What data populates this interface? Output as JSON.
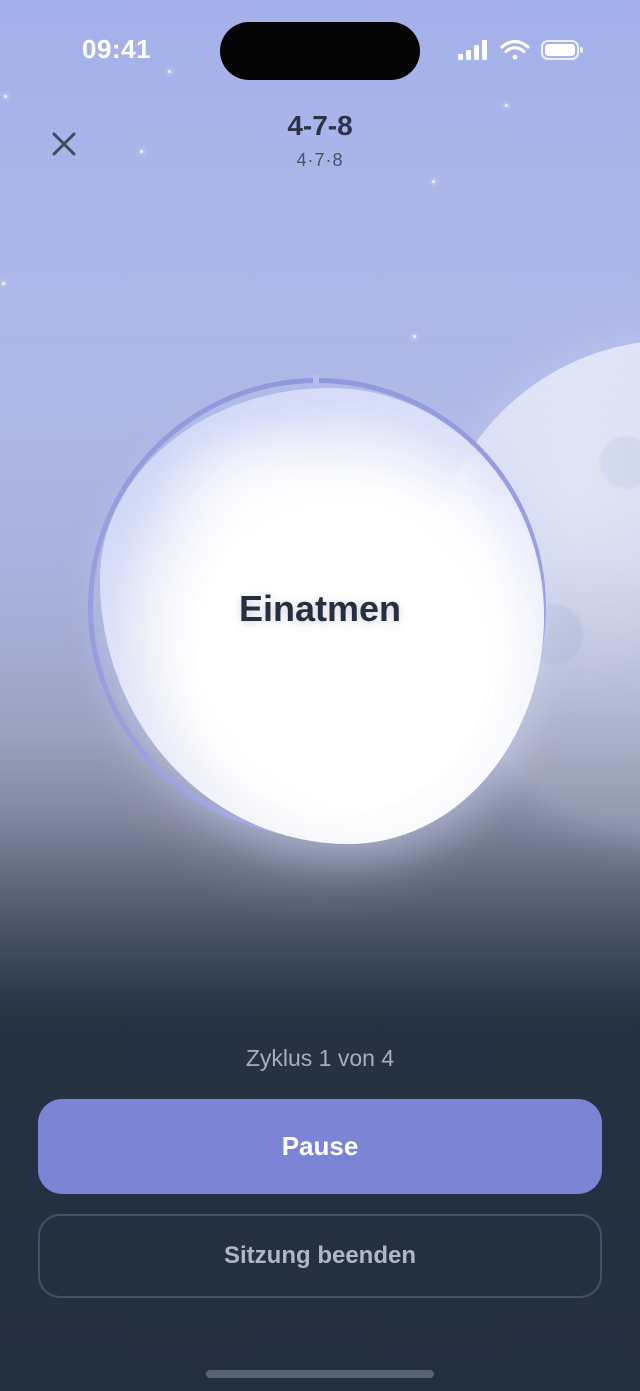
{
  "status_bar": {
    "time": "09:41",
    "icons": [
      "cellular-signal-icon",
      "wifi-icon",
      "battery-icon"
    ]
  },
  "header": {
    "close_icon": "close-icon",
    "title": "4-7-8",
    "subtitle": "4·7·8"
  },
  "breathing": {
    "phase_label": "Einatmen"
  },
  "session": {
    "cycle_text": "Zyklus 1 von 4",
    "pause_label": "Pause",
    "end_label": "Sitzung beenden"
  },
  "colors": {
    "accent": "#7b84d5",
    "ring": "#8f95dc",
    "background_bottom": "#232e3f",
    "sky_top": "#a4b0ea"
  }
}
